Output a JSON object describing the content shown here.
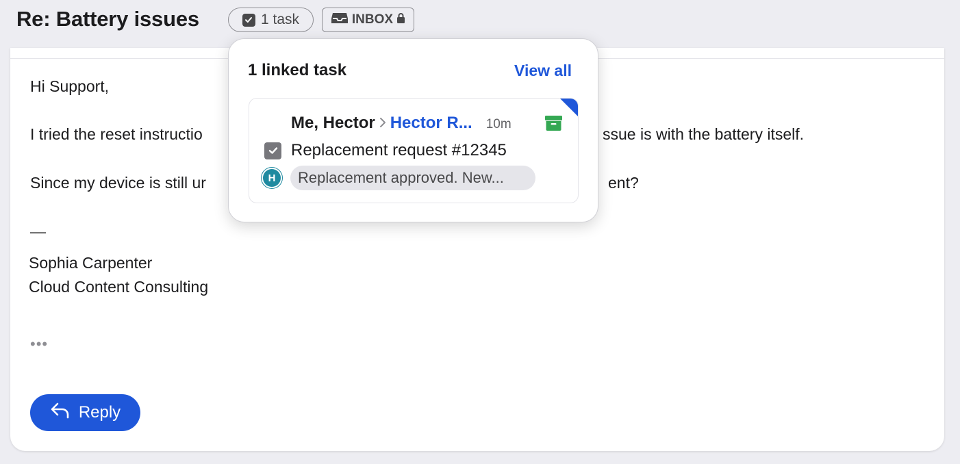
{
  "email": {
    "subject": "Re: Battery issues",
    "task_chip_label": "1 task",
    "inbox_chip_label": "INBOX",
    "greeting": "Hi Support,",
    "line1_left": "I tried the reset instructio",
    "line1_right": "ssue is with the battery itself.",
    "line2_left": "Since my device is still ur",
    "line2_right": "ent?",
    "sig_dash": "—",
    "sig_name": "Sophia Carpenter",
    "sig_company": "Cloud Content Consulting",
    "more_label": "•••",
    "reply_label": "Reply"
  },
  "popover": {
    "title": "1 linked task",
    "view_all": "View all",
    "task": {
      "participants": "Me, Hector",
      "assignee": "Hector R...",
      "time": "10m",
      "title": "Replacement request #12345",
      "avatar_initial": "H",
      "preview": "Replacement approved. New..."
    }
  },
  "colors": {
    "accent": "#1f57d9",
    "archive": "#34a853",
    "avatar": "#1f8aa0",
    "background": "#ededf2"
  },
  "icons": [
    "checkbox-icon",
    "inbox-tray-icon",
    "lock-icon",
    "chevron-right-icon",
    "archive-box-icon",
    "reply-arrow-icon"
  ]
}
